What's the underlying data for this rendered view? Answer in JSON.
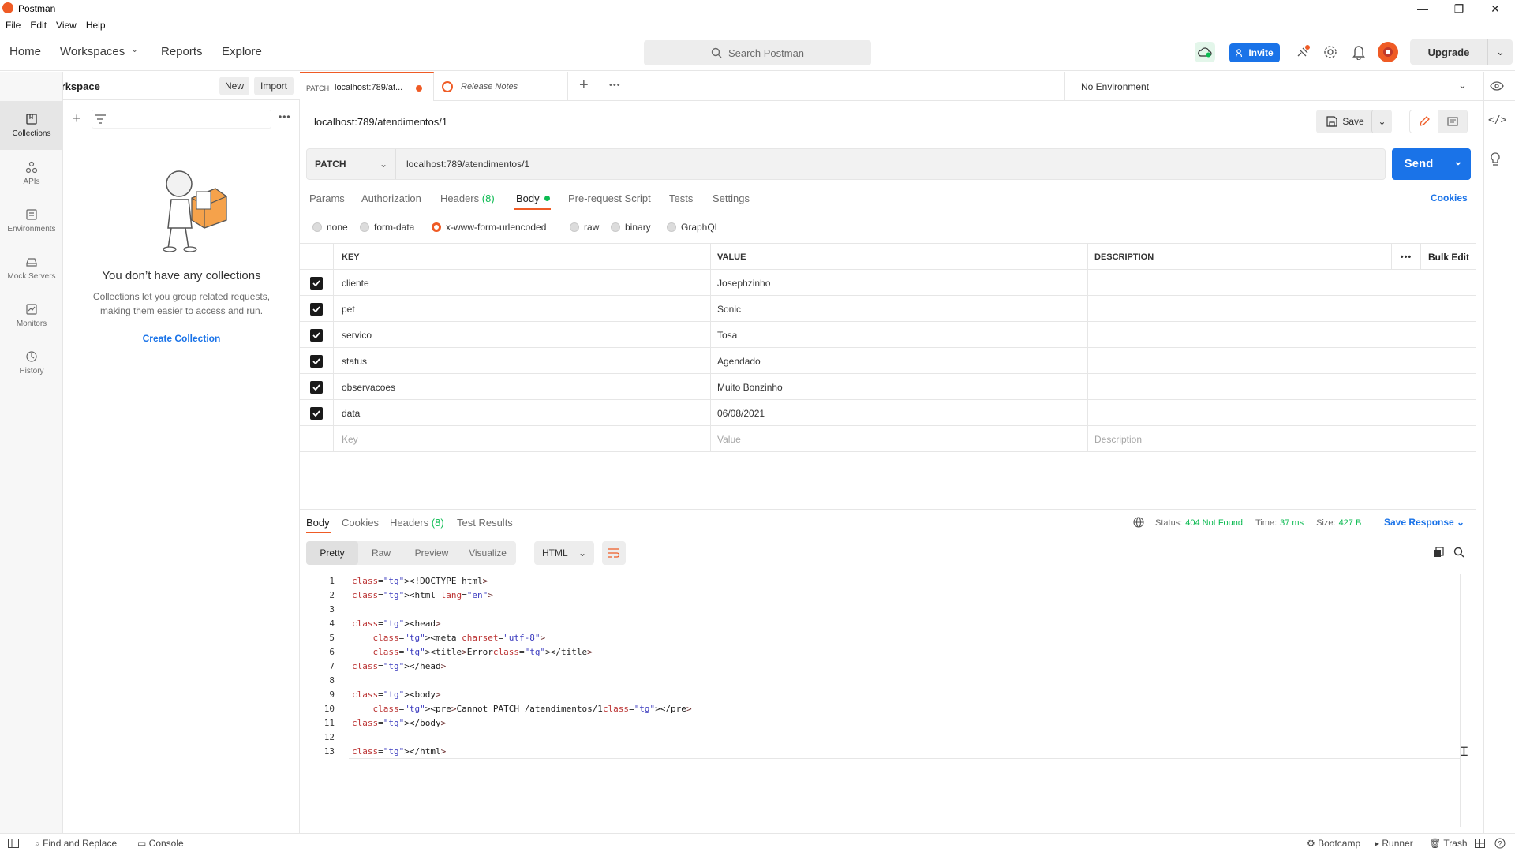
{
  "window": {
    "title": "Postman",
    "menu": [
      "File",
      "Edit",
      "View",
      "Help"
    ]
  },
  "header": {
    "nav": [
      "Home",
      "Workspaces",
      "Reports",
      "Explore"
    ],
    "search_placeholder": "Search Postman",
    "invite_label": "Invite",
    "upgrade_label": "Upgrade"
  },
  "workspace": {
    "name": "My Workspace",
    "new_label": "New",
    "import_label": "Import"
  },
  "rail": [
    {
      "label": "Collections",
      "icon": "collections-icon"
    },
    {
      "label": "APIs",
      "icon": "apis-icon"
    },
    {
      "label": "Environments",
      "icon": "environments-icon"
    },
    {
      "label": "Mock Servers",
      "icon": "mock-servers-icon"
    },
    {
      "label": "Monitors",
      "icon": "monitors-icon"
    },
    {
      "label": "History",
      "icon": "history-icon"
    }
  ],
  "empty_state": {
    "title": "You don’t have any collections",
    "text1": "Collections let you group related requests,",
    "text2": "making them easier to access and run.",
    "cta": "Create Collection"
  },
  "tabs": [
    {
      "method": "PATCH",
      "title": "localhost:789/at..."
    },
    {
      "title": "Release Notes"
    }
  ],
  "environment": "No Environment",
  "request": {
    "name": "localhost:789/atendimentos/1",
    "save_label": "Save",
    "method": "PATCH",
    "url": "localhost:789/atendimentos/1",
    "send_label": "Send",
    "cookies_label": "Cookies",
    "tabs": [
      "Params",
      "Authorization",
      "Headers",
      "(8)",
      "Body",
      "Pre-request Script",
      "Tests",
      "Settings"
    ],
    "body_types": [
      "none",
      "form-data",
      "x-www-form-urlencoded",
      "raw",
      "binary",
      "GraphQL"
    ],
    "columns": {
      "key": "KEY",
      "value": "VALUE",
      "description": "DESCRIPTION",
      "bulk_edit": "Bulk Edit"
    },
    "rows": [
      {
        "key": "cliente",
        "value": "Josephzinho"
      },
      {
        "key": "pet",
        "value": "Sonic"
      },
      {
        "key": "servico",
        "value": "Tosa"
      },
      {
        "key": "status",
        "value": "Agendado"
      },
      {
        "key": "observacoes",
        "value": "Muito Bonzinho"
      },
      {
        "key": "data",
        "value": "06/08/2021"
      }
    ],
    "placeholders": {
      "key": "Key",
      "value": "Value",
      "description": "Description"
    }
  },
  "response": {
    "tabs": [
      "Body",
      "Cookies",
      "Headers",
      "(8)",
      "Test Results"
    ],
    "status_label": "Status:",
    "status_value": "404 Not Found",
    "time_label": "Time:",
    "time_value": "37 ms",
    "size_label": "Size:",
    "size_value": "427 B",
    "save_response": "Save Response",
    "view_modes": [
      "Pretty",
      "Raw",
      "Preview",
      "Visualize"
    ],
    "format": "HTML",
    "code": [
      "<!DOCTYPE html>",
      "<html lang=\"en\">",
      "",
      "<head>",
      "    <meta charset=\"utf-8\">",
      "    <title>Error</title>",
      "</head>",
      "",
      "<body>",
      "    <pre>Cannot PATCH /atendimentos/1</pre>",
      "</body>",
      "",
      "</html>"
    ]
  },
  "footer": {
    "find_replace": "Find and Replace",
    "console": "Console",
    "bootcamp": "Bootcamp",
    "runner": "Runner",
    "trash": "Trash"
  },
  "colors": {
    "accent": "#ef5b25",
    "primary": "#1a73e8",
    "success": "#0cbb52"
  }
}
